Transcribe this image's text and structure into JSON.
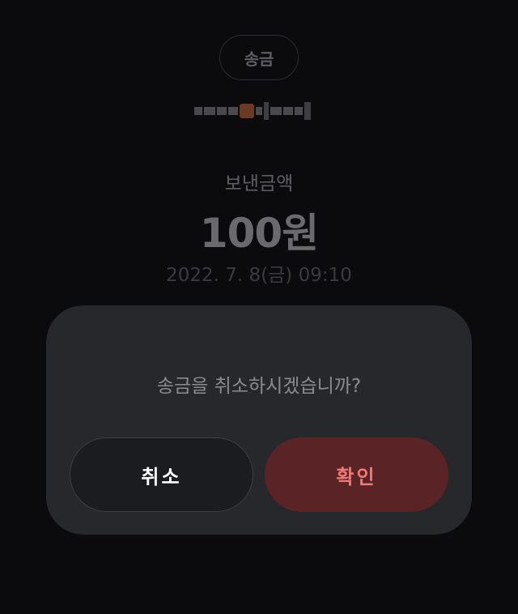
{
  "header": {
    "tag_label": "송금"
  },
  "transfer": {
    "label": "보낸금액",
    "amount": "100원",
    "datetime": "2022. 7. 8(금) 09:10"
  },
  "dialog": {
    "message": "송금을 취소하시겠습니까?",
    "cancel_label": "취소",
    "confirm_label": "확인"
  }
}
